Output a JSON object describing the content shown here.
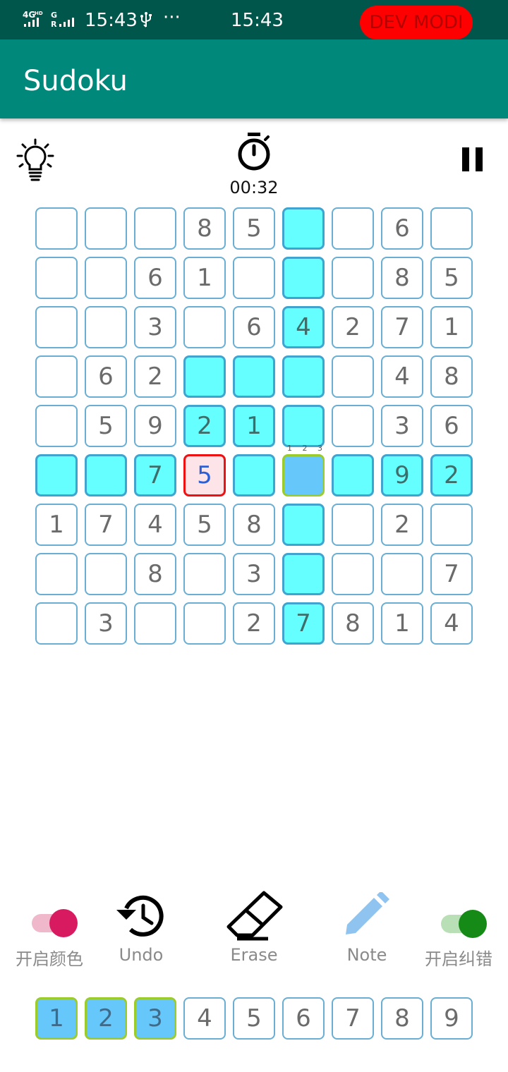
{
  "status_bar": {
    "network": "4G",
    "signal_label": "G R",
    "left_time": "15:43",
    "usb_icon": "usb-icon",
    "more": "···",
    "center_time": "15:43",
    "dev_badge": "DEV MODI"
  },
  "app_bar": {
    "title": "Sudoku"
  },
  "toolbar": {
    "hint_icon": "lightbulb-icon",
    "timer": "00:32",
    "pause_icon": "pause-icon"
  },
  "board": {
    "rows": [
      [
        "",
        "",
        "",
        "8",
        "5",
        "",
        "",
        "6",
        ""
      ],
      [
        "",
        "",
        "6",
        "1",
        "",
        "",
        "",
        "8",
        "5"
      ],
      [
        "",
        "",
        "3",
        "",
        "6",
        "4",
        "2",
        "7",
        "1"
      ],
      [
        "",
        "6",
        "2",
        "",
        "",
        "",
        "",
        "4",
        "8"
      ],
      [
        "",
        "5",
        "9",
        "2",
        "1",
        "",
        "",
        "3",
        "6"
      ],
      [
        "",
        "",
        "7",
        "5",
        "",
        "",
        "",
        "9",
        "2"
      ],
      [
        "1",
        "7",
        "4",
        "5",
        "8",
        "",
        "",
        "2",
        ""
      ],
      [
        "",
        "",
        "8",
        "",
        "3",
        "",
        "",
        "",
        "7"
      ],
      [
        "",
        "3",
        "",
        "",
        "2",
        "7",
        "8",
        "1",
        "4"
      ]
    ],
    "highlighted": [
      [
        0,
        5
      ],
      [
        1,
        5
      ],
      [
        2,
        5
      ],
      [
        3,
        3
      ],
      [
        3,
        4
      ],
      [
        3,
        5
      ],
      [
        4,
        3
      ],
      [
        4,
        4
      ],
      [
        4,
        5
      ],
      [
        5,
        0
      ],
      [
        5,
        1
      ],
      [
        5,
        2
      ],
      [
        5,
        4
      ],
      [
        5,
        6
      ],
      [
        5,
        7
      ],
      [
        5,
        8
      ],
      [
        6,
        5
      ],
      [
        7,
        5
      ],
      [
        8,
        5
      ]
    ],
    "error_cell": [
      5,
      3
    ],
    "selected_cell": [
      5,
      5
    ],
    "selected_notes": [
      "1",
      "2",
      "3"
    ]
  },
  "controls": {
    "color_toggle_label": "开启颜色",
    "color_toggle_on": true,
    "undo_label": "Undo",
    "erase_label": "Erase",
    "note_label": "Note",
    "correct_toggle_label": "开启纠错",
    "correct_toggle_on": true
  },
  "number_pad": {
    "numbers": [
      "1",
      "2",
      "3",
      "4",
      "5",
      "6",
      "7",
      "8",
      "9"
    ],
    "active": [
      "1",
      "2",
      "3"
    ]
  },
  "colors": {
    "app_bar": "#00897b",
    "status_bar": "#00564b",
    "highlight": "#66ffff",
    "error_border": "#ee1111",
    "selected": "#66c7fb",
    "selected_border": "#9ccc2c",
    "color_toggle": "#d81b60",
    "correct_toggle": "#168a16"
  }
}
